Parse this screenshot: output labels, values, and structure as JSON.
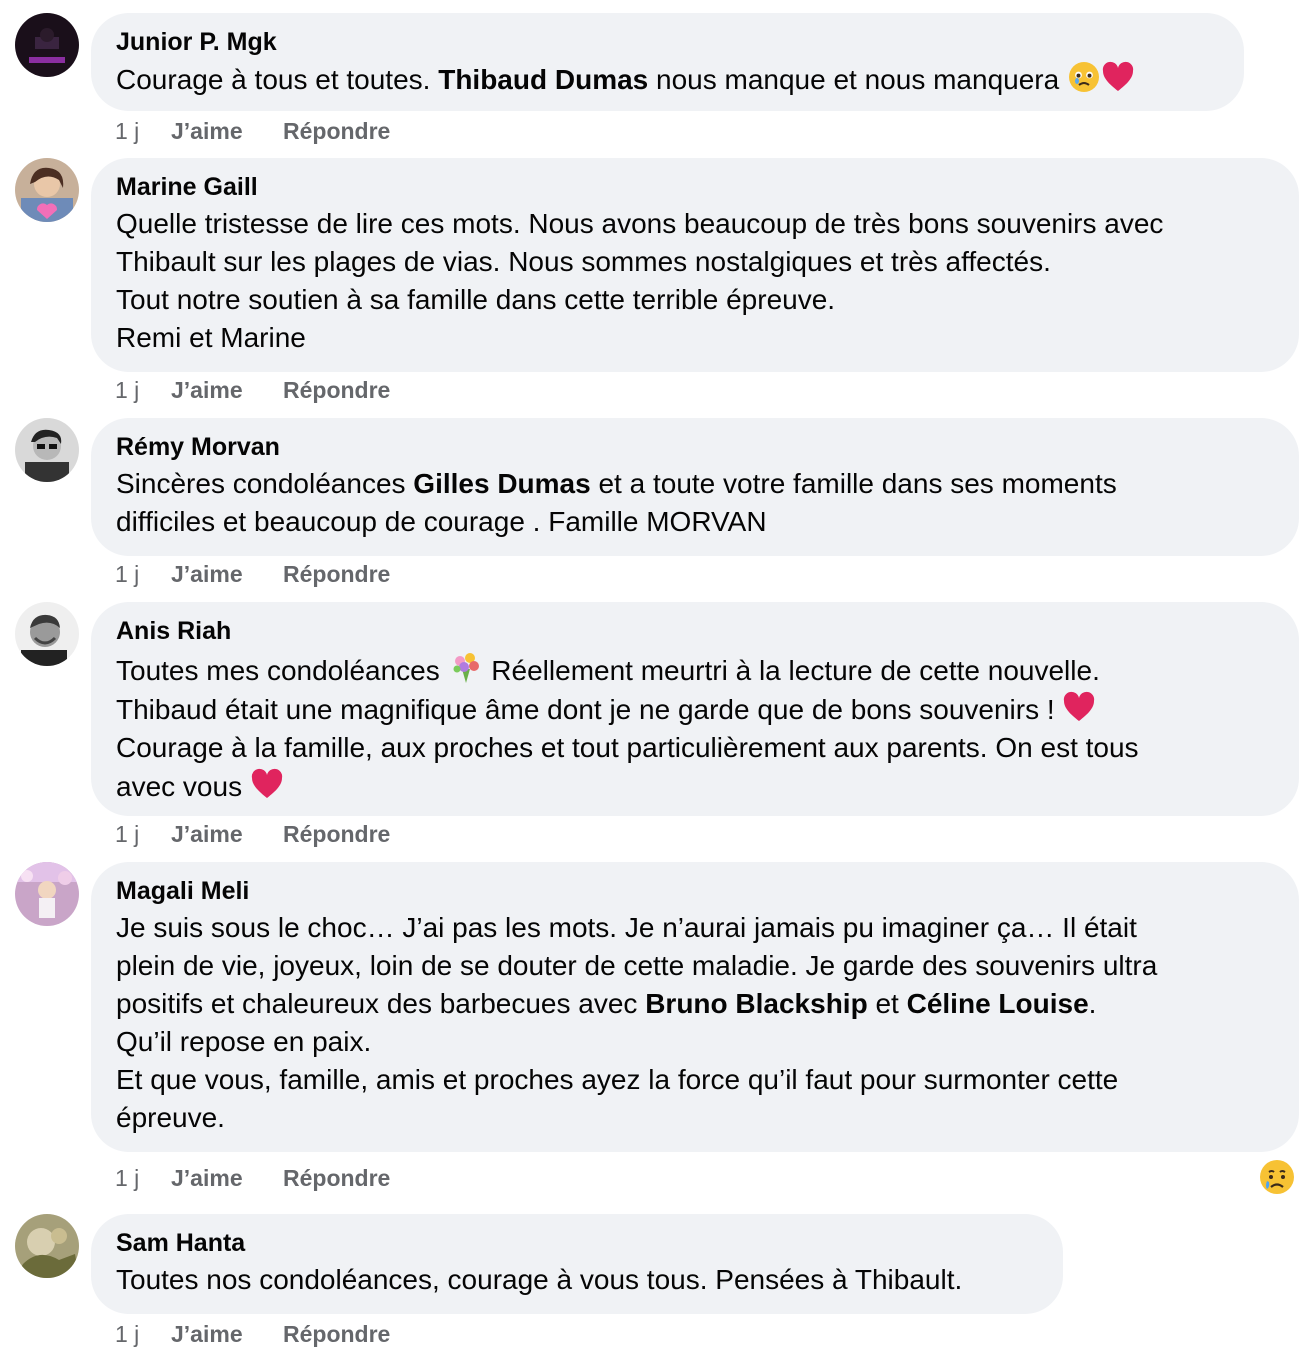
{
  "comments": [
    {
      "author": "Junior P. Mgk",
      "lines": [
        [
          "Courage à tous et toutes. ",
          "Thibaud Dumas",
          " nous manque et nous manquera "
        ]
      ],
      "time": "1 j",
      "like": "J’aime",
      "reply": "Répondre"
    },
    {
      "author": "Marine Gaill",
      "lines": [
        "Quelle tristesse de lire ces mots. Nous avons beaucoup de très bons souvenirs avec",
        "Thibault sur les plages de vias. Nous sommes nostalgiques et très affectés.",
        "Tout notre soutien à sa famille dans cette terrible épreuve.",
        "Remi et Marine"
      ],
      "time": "1 j",
      "like": "J’aime",
      "reply": "Répondre"
    },
    {
      "author": "Rémy Morvan",
      "lines": [
        [
          "Sincères condoléances ",
          "Gilles Dumas",
          " et a toute votre famille dans ses moments"
        ],
        "difficiles et beaucoup de courage . Famille MORVAN"
      ],
      "time": "1 j",
      "like": "J’aime",
      "reply": "Répondre"
    },
    {
      "author": "Anis Riah",
      "lines": [
        [
          "Toutes mes condoléances ",
          " Réellement meurtri à la lecture de cette nouvelle."
        ],
        "Thibaud était une magnifique âme dont je ne garde que de bons souvenirs ! ",
        "Courage à la famille, aux proches et tout particulièrement aux parents. On est tous",
        "avec vous "
      ],
      "time": "1 j",
      "like": "J’aime",
      "reply": "Répondre"
    },
    {
      "author": "Magali Meli",
      "lines": [
        "Je suis sous le choc… J’ai pas les mots. Je n’aurai jamais pu imaginer ça… Il était",
        "plein de vie, joyeux, loin de se douter de cette maladie. Je garde des souvenirs ultra",
        [
          "positifs et chaleureux des barbecues avec ",
          "Bruno Blackship",
          " et ",
          "Céline Louise",
          "."
        ],
        "Qu’il repose en paix.",
        "Et que vous, famille, amis et proches ayez la force qu’il faut pour surmonter cette",
        "épreuve."
      ],
      "time": "1 j",
      "like": "J’aime",
      "reply": "Répondre"
    },
    {
      "author": "Sam Hanta",
      "lines": [
        "Toutes nos condoléances, courage à vous tous. Pensées à Thibault."
      ],
      "time": "1 j",
      "like": "J’aime",
      "reply": "Répondre"
    }
  ],
  "colors": {
    "bubble": "#f0f2f5",
    "meta": "#65676b",
    "text": "#050505",
    "heart": "#e0245e"
  },
  "icons": [
    "crying-face-emoji",
    "red-heart-emoji",
    "bouquet-emoji",
    "sad-reaction-icon"
  ]
}
